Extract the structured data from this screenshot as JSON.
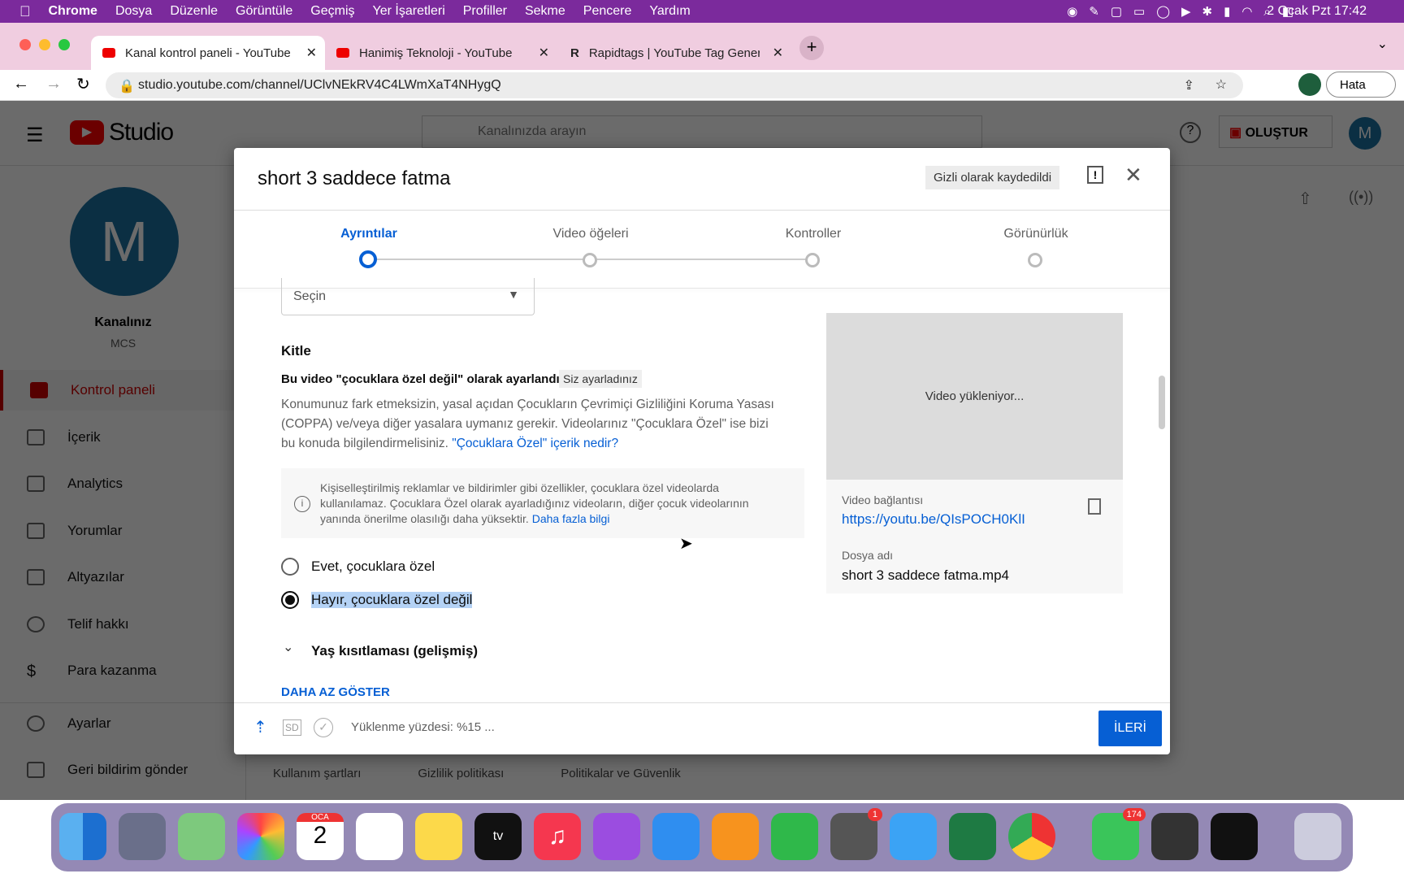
{
  "menubar": {
    "app": "Chrome",
    "items": [
      "Dosya",
      "Düzenle",
      "Görüntüle",
      "Geçmiş",
      "Yer İşaretleri",
      "Profiller",
      "Sekme",
      "Pencere",
      "Yardım"
    ],
    "datetime": "2 Ocak Pzt  17:42"
  },
  "tabs": [
    {
      "title": "Kanal kontrol paneli - YouTube"
    },
    {
      "title": "Hanimiş Teknoloji - YouTube"
    },
    {
      "title": "Rapidtags | YouTube Tag Gener"
    }
  ],
  "address": {
    "url": "studio.youtube.com/channel/UClvNEkRV4C4LWmXaT4NHygQ",
    "profile_button": "Hata"
  },
  "studio": {
    "logo": "Studio",
    "search_placeholder": "Kanalınızda arayın",
    "create": "OLUŞTUR",
    "avatar": "M"
  },
  "channel": {
    "avatar": "M",
    "name": "Kanalınız",
    "sub": "MCS"
  },
  "sidebar": {
    "items": [
      {
        "label": "Kontrol paneli",
        "icon": "dashboard-icon"
      },
      {
        "label": "İçerik",
        "icon": "content-icon"
      },
      {
        "label": "Analytics",
        "icon": "analytics-icon"
      },
      {
        "label": "Yorumlar",
        "icon": "comments-icon"
      },
      {
        "label": "Altyazılar",
        "icon": "subtitles-icon"
      },
      {
        "label": "Telif hakkı",
        "icon": "copyright-icon"
      },
      {
        "label": "Para kazanma",
        "icon": "dollar-icon"
      },
      {
        "label": "Ayarlar",
        "icon": "gear-icon"
      },
      {
        "label": "Geri bildirim gönder",
        "icon": "feedback-icon"
      }
    ]
  },
  "footer_links": [
    "Kullanım şartları",
    "Gizlilik politikası",
    "Politikalar ve Güvenlik"
  ],
  "dialog": {
    "title": "short 3 saddece fatma",
    "saved_badge": "Gizli olarak kaydedildi",
    "steps": [
      "Ayrıntılar",
      "Video öğeleri",
      "Kontroller",
      "Görünürlük"
    ],
    "active_step": 0,
    "select_value": "Seçin",
    "audience": {
      "heading": "Kitle",
      "status": "Bu video \"çocuklara özel değil\" olarak ayarlandı",
      "status_badge": "Siz ayarladınız",
      "desc": "Konumunuz fark etmeksizin, yasal açıdan Çocukların Çevrimiçi Gizliliğini Koruma Yasası (COPPA) ve/veya diğer yasalara uymanız gerekir. Videolarınız \"Çocuklara Özel\" ise bizi bu konuda bilgilendirmelisiniz. ",
      "desc_link": "\"Çocuklara Özel\" içerik nedir?",
      "info": "Kişiselleştirilmiş reklamlar ve bildirimler gibi özellikler, çocuklara özel videolarda kullanılamaz. Çocuklara Özel olarak ayarladığınız videoların, diğer çocuk videolarının yanında önerilme olasılığı daha yüksektir. ",
      "info_link": "Daha fazla bilgi",
      "option_yes": "Evet, çocuklara özel",
      "option_no": "Hayır, çocuklara özel değil",
      "selected": "option_no"
    },
    "age_restriction": "Yaş kısıtlaması (gelişmiş)",
    "show_less": "DAHA AZ GÖSTER",
    "preview": {
      "loading": "Video yükleniyor...",
      "link_label": "Video bağlantısı",
      "link": "https://youtu.be/QIsPOCH0KlI",
      "file_label": "Dosya adı",
      "file": "short 3 saddece fatma.mp4"
    },
    "footer": {
      "sd_badge": "SD",
      "upload_status": "Yüklenme yüzdesi: %15 ...",
      "next": "İLERİ"
    }
  },
  "dock": {
    "calendar_month": "OCA",
    "calendar_day": "2",
    "badges": {
      "settings": "1",
      "messages": "174"
    }
  },
  "colors": {
    "accent": "#065fd4",
    "menubar": "#7b2a9c",
    "youtube_red": "#ff0000"
  }
}
